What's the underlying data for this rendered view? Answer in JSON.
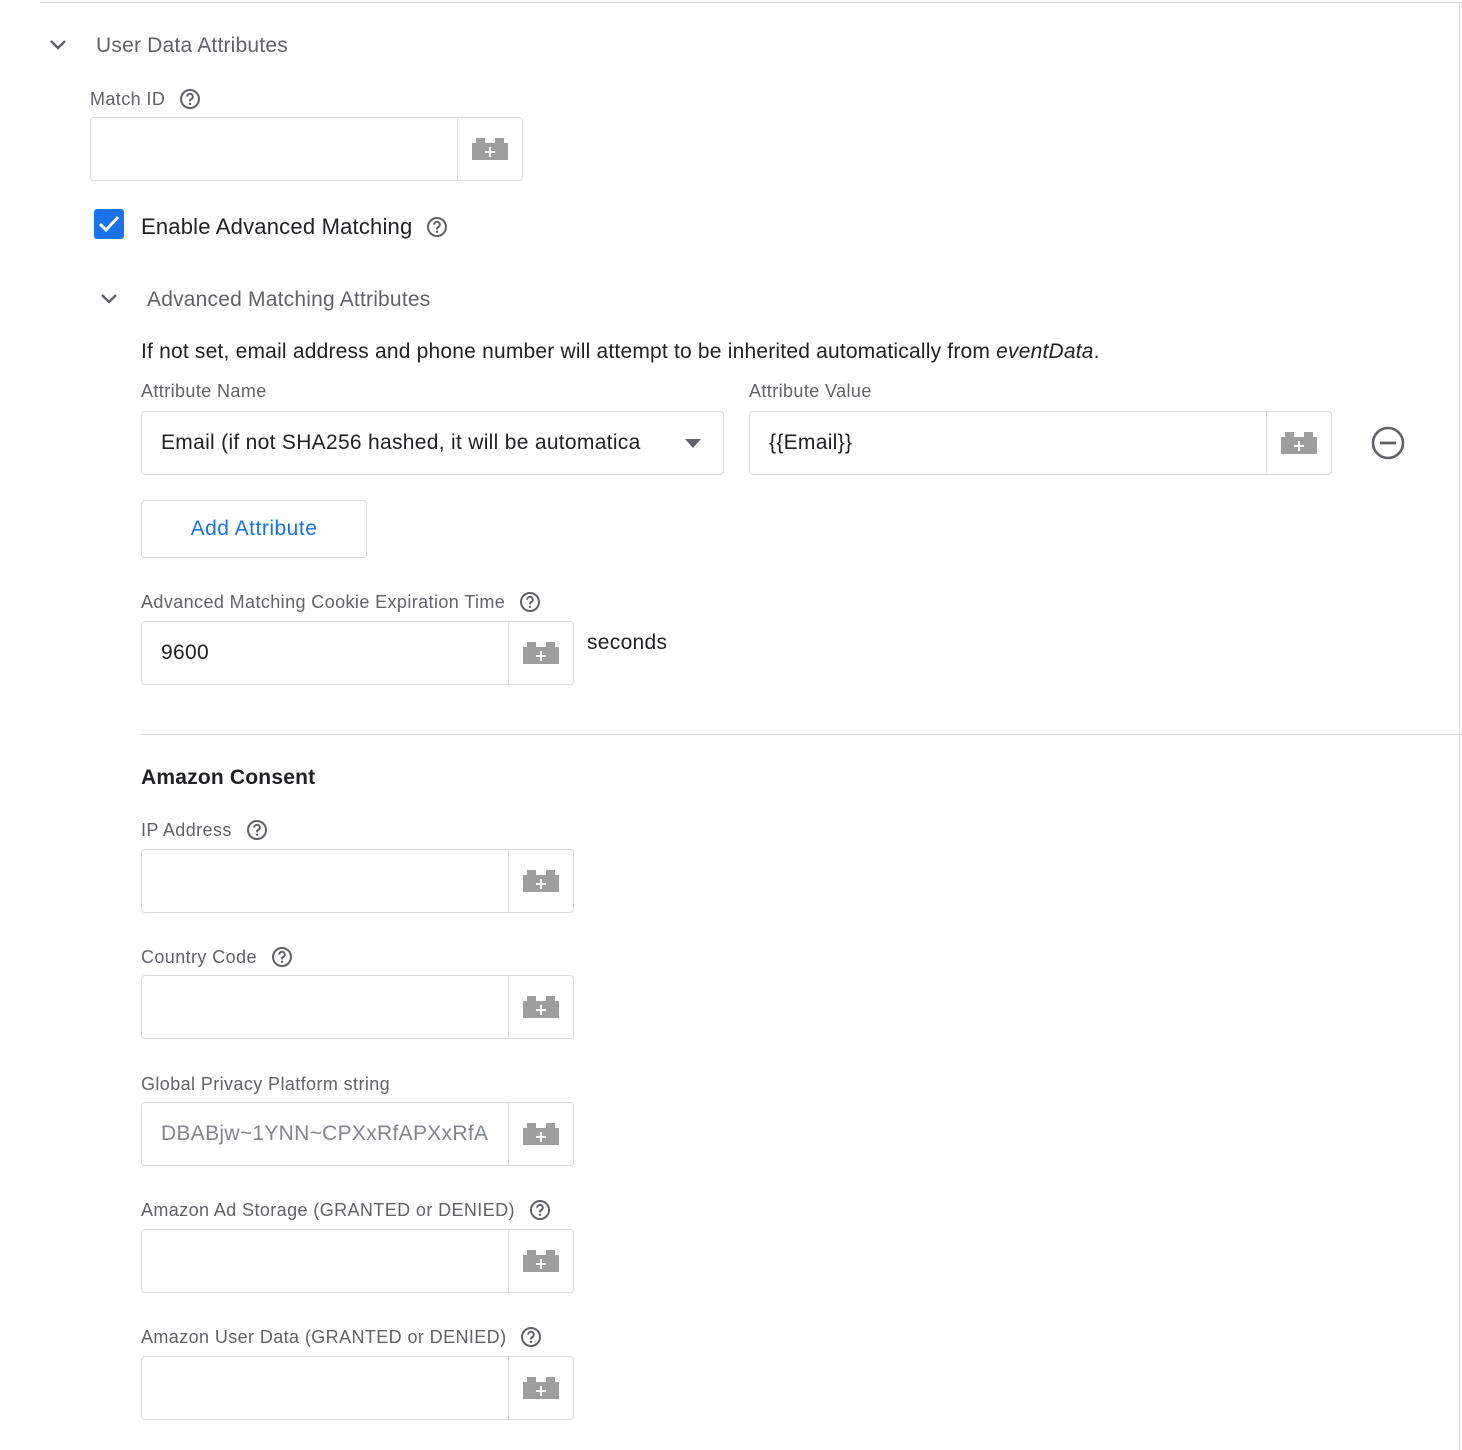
{
  "user_data_section": {
    "title": "User Data Attributes",
    "match_id": {
      "label": "Match ID",
      "value": "",
      "placeholder": ""
    },
    "enable_advanced_matching": {
      "label": "Enable Advanced Matching",
      "checked": true
    }
  },
  "advanced_matching_section": {
    "title": "Advanced Matching Attributes",
    "description_prefix": "If not set, email address and phone number will attempt to be inherited automatically from ",
    "description_em": "eventData",
    "description_suffix": ".",
    "attribute_name_label": "Attribute Name",
    "attribute_value_label": "Attribute Value",
    "rows": [
      {
        "name": "Email (if not SHA256 hashed, it will be automatica",
        "value": "{{Email}}"
      }
    ],
    "add_attribute_label": "Add Attribute",
    "cookie_expiration": {
      "label": "Advanced Matching Cookie Expiration Time",
      "value": "9600",
      "unit": "seconds"
    }
  },
  "amazon_consent": {
    "title": "Amazon Consent",
    "ip_address": {
      "label": "IP Address",
      "value": ""
    },
    "country_code": {
      "label": "Country Code",
      "value": ""
    },
    "gpp_string": {
      "label": "Global Privacy Platform string",
      "placeholder": "DBABjw~1YNN~CPXxRfAPXxRfA"
    },
    "ad_storage": {
      "label": "Amazon Ad Storage (GRANTED or DENIED)",
      "value": ""
    },
    "user_data": {
      "label": "Amazon User Data (GRANTED or DENIED)",
      "value": ""
    }
  },
  "colors": {
    "accent": "#1a73e8",
    "border": "#dadce0",
    "muted_text": "#5f6368",
    "icon_grey": "#9e9e9e"
  },
  "icons": {
    "chevron": "chevron-down-icon",
    "help": "help-circle-icon",
    "variable": "variable-brick-icon",
    "dropdown": "caret-down-icon",
    "remove": "remove-circle-icon",
    "check": "check-icon"
  }
}
